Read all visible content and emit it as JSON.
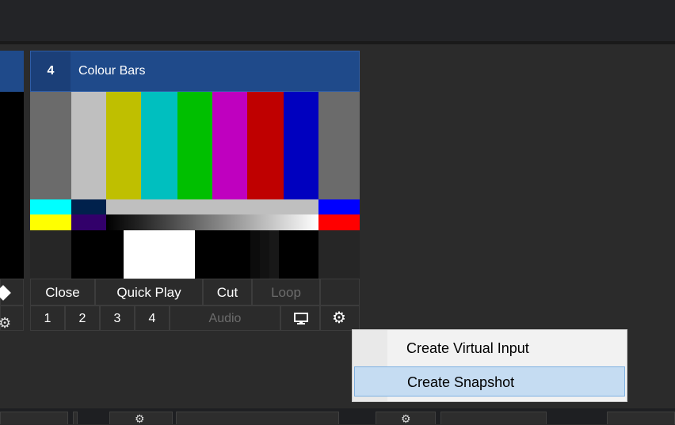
{
  "input_tile": {
    "number": "4",
    "title": "Colour Bars",
    "buttons": {
      "close": "Close",
      "quick_play": "Quick Play",
      "cut": "Cut",
      "loop": "Loop",
      "one": "1",
      "two": "2",
      "three": "3",
      "four": "4",
      "audio": "Audio"
    },
    "icons": {
      "monitor": "monitor-icon",
      "settings": "gear-icon"
    },
    "colour_bars": [
      "#6b6b6b",
      "#bfbfbf",
      "#bfbf00",
      "#00bfbf",
      "#00bf00",
      "#bf00bf",
      "#bf0000",
      "#0000bf",
      "#6b6b6b"
    ]
  },
  "context_menu": {
    "items": [
      {
        "label": "Create Virtual Input",
        "selected": false
      },
      {
        "label": "Create Snapshot",
        "selected": true
      }
    ]
  },
  "colors": {
    "background": "#2b2b2b",
    "header_blue": "#1f4a8a",
    "menu_bg": "#f2f2f2",
    "menu_selected": "#c5dcf2"
  }
}
